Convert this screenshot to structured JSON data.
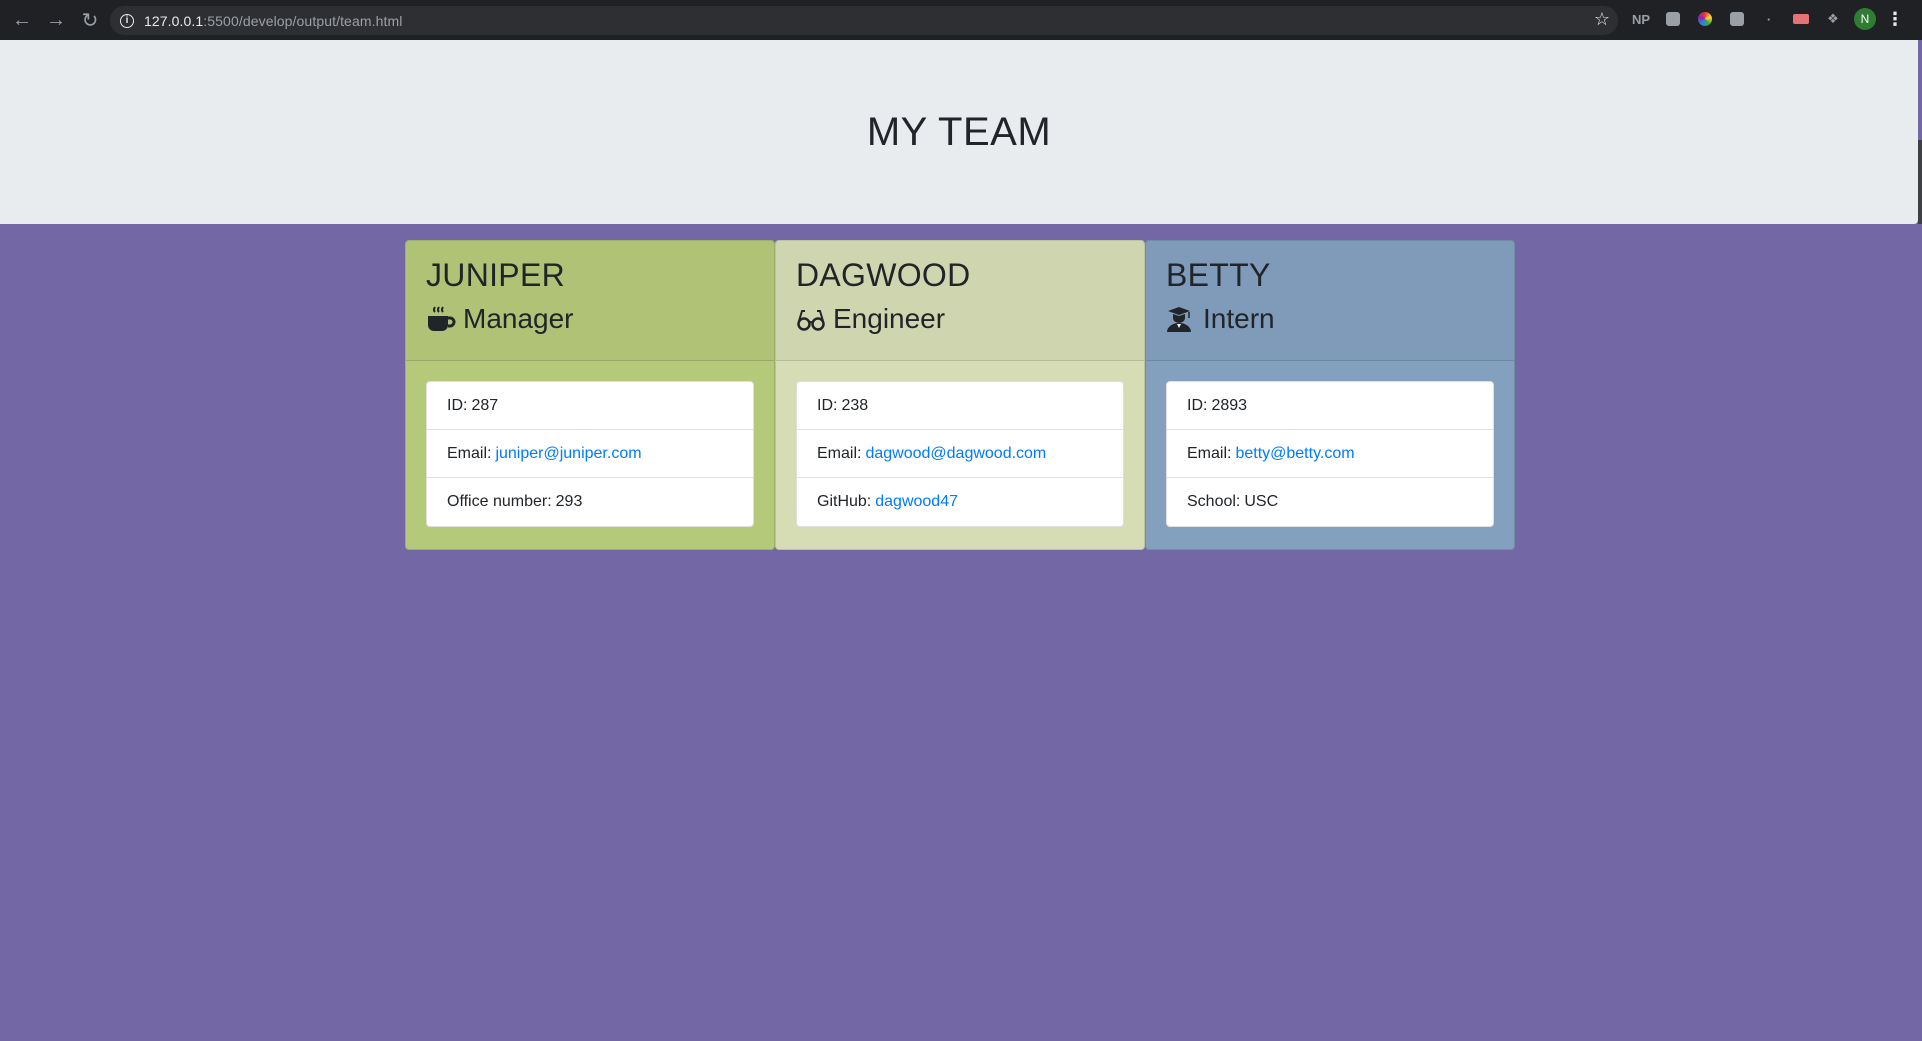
{
  "browser": {
    "url_host": "127.0.0.1",
    "url_rest": ":5500/develop/output/team.html",
    "extensions": [
      "NP"
    ],
    "avatar_letter": "N"
  },
  "page": {
    "title": "MY TEAM",
    "background": "#7367a6"
  },
  "cards": [
    {
      "name": "JUNIPER",
      "role": "Manager",
      "icon": "mug-icon",
      "color": "#b5c97a",
      "fields": [
        {
          "label": "ID:",
          "value": "287",
          "link": false
        },
        {
          "label": "Email:",
          "value": "juniper@juniper.com",
          "link": true
        },
        {
          "label": "Office number:",
          "value": "293",
          "link": false
        }
      ]
    },
    {
      "name": "DAGWOOD",
      "role": "Engineer",
      "icon": "glasses-icon",
      "color": "#d6ddb5",
      "fields": [
        {
          "label": "ID:",
          "value": "238",
          "link": false
        },
        {
          "label": "Email:",
          "value": "dagwood@dagwood.com",
          "link": true
        },
        {
          "label": "GitHub:",
          "value": "dagwood47",
          "link": true
        }
      ]
    },
    {
      "name": "BETTY",
      "role": "Intern",
      "icon": "graduate-icon",
      "color": "#84a0bf",
      "fields": [
        {
          "label": "ID:",
          "value": "2893",
          "link": false
        },
        {
          "label": "Email:",
          "value": "betty@betty.com",
          "link": true
        },
        {
          "label": "School:",
          "value": "USC",
          "link": false
        }
      ]
    }
  ]
}
